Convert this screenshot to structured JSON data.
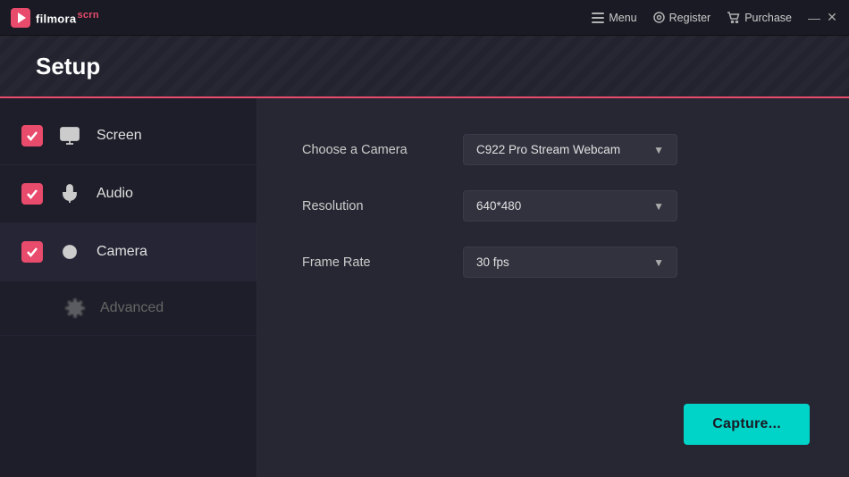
{
  "app": {
    "logo_text": "filmora",
    "logo_scrn": "scrn",
    "logo_icon": "▶"
  },
  "titlebar": {
    "menu_label": "Menu",
    "register_label": "Register",
    "purchase_label": "Purchase",
    "minimize_label": "—",
    "close_label": "✕"
  },
  "header": {
    "title": "Setup"
  },
  "sidebar": {
    "items": [
      {
        "id": "screen",
        "label": "Screen",
        "checked": true,
        "disabled": false
      },
      {
        "id": "audio",
        "label": "Audio",
        "checked": true,
        "disabled": false
      },
      {
        "id": "camera",
        "label": "Camera",
        "checked": true,
        "disabled": false
      },
      {
        "id": "advanced",
        "label": "Advanced",
        "checked": false,
        "disabled": true
      }
    ]
  },
  "content": {
    "fields": [
      {
        "id": "camera",
        "label": "Choose a Camera",
        "value": "C922 Pro Stream Webcam"
      },
      {
        "id": "resolution",
        "label": "Resolution",
        "value": "640*480"
      },
      {
        "id": "framerate",
        "label": "Frame Rate",
        "value": "30 fps"
      }
    ],
    "capture_button": "Capture..."
  }
}
